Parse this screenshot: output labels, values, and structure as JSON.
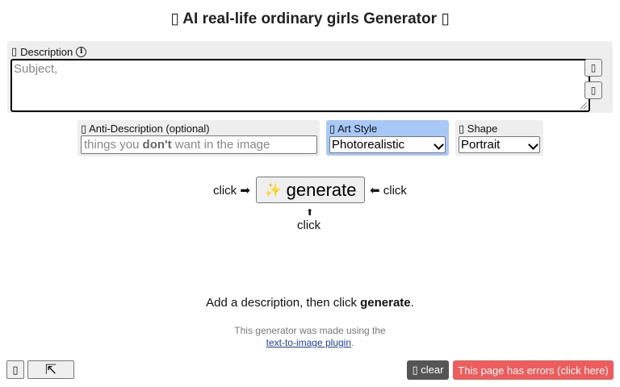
{
  "header": {
    "title": "▯ AI real-life ordinary girls Generator ▯"
  },
  "description": {
    "icon_glyph": "▯",
    "label": "Description",
    "info_glyph": "i",
    "placeholder": "Subject,",
    "side_button_1": "▯",
    "side_button_2": "▯"
  },
  "anti_description": {
    "icon_glyph": "▯",
    "label": "Anti-Description (optional)",
    "placeholder_pre": "things you ",
    "placeholder_bold": "don't",
    "placeholder_post": " want in the image"
  },
  "art_style": {
    "icon_glyph": "▯",
    "label": "Art Style",
    "selected": "Photorealistic"
  },
  "shape": {
    "icon_glyph": "▯",
    "label": "Shape",
    "selected": "Portrait"
  },
  "generate": {
    "label": "generate",
    "sparkle": "✨",
    "click_left": "click ➡",
    "click_right": "⬅ click",
    "click_below": "click",
    "arrow_up": "⬆"
  },
  "hint": {
    "pre": "Add a description, then click ",
    "bold": "generate",
    "post": "."
  },
  "credit": {
    "line1": "This generator was made using the",
    "link": "text-to-image plugin",
    "post": "."
  },
  "footer": {
    "left_button_1": "▯",
    "left_button_2": "⇱",
    "clear_label": "▯ clear",
    "errors_label": "This page has errors (click here)"
  },
  "colors": {
    "art_style_highlight": "#a8c8f8",
    "errors_button": "#ee5c5c",
    "clear_button": "#555555"
  }
}
